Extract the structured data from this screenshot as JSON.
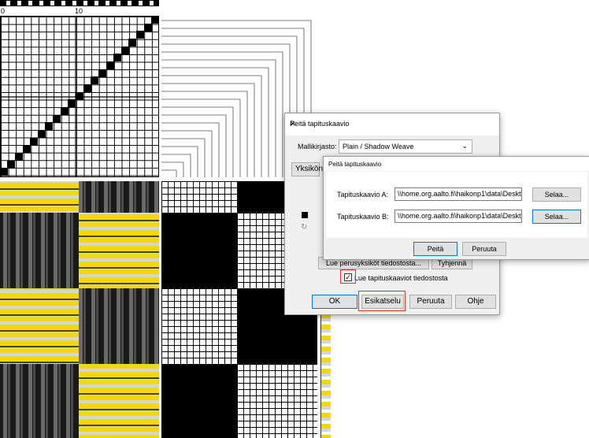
{
  "ruler": {
    "label_start": "0",
    "label_ten": "10"
  },
  "dialog_back": {
    "title": "Peitä tapituskaavio",
    "library_label": "Mallikirjasto:",
    "library_value": "Plain / Shadow Weave",
    "units_label": "Yksikön",
    "read_units_button": "Lue perusyksiköt tiedostosta...",
    "clear_button": "Tyhjennä",
    "read_tieups_label": "Lue tapituskaaviot tiedostosta",
    "ok_button": "OK",
    "preview_button": "Esikatselu",
    "cancel_button": "Peruuta",
    "help_button": "Ohje"
  },
  "dialog_front": {
    "title": "Peitä tapituskaavio",
    "tieup_a_label": "Tapituskaavio A:",
    "tieup_a_value": "\\\\home.org.aalto.fi\\haikonp1\\data\\Desktop\\AO",
    "tieup_b_label": "Tapituskaavio B:",
    "tieup_b_value": "\\\\home.org.aalto.fi\\haikonp1\\data\\Desktop\\AO",
    "browse_label": "Selaa...",
    "cover_button": "Peitä",
    "cancel_button": "Peruuta"
  },
  "colors": {
    "yellow": "#f5d800",
    "light_blue": "#ccd6ee",
    "dark": "#3a3a3a",
    "highlight": "#e03030",
    "accent": "#0078d7"
  },
  "icons": [
    "close-icon",
    "chevron-down-icon",
    "checkbox-checked-icon",
    "black-square-icon",
    "refresh-icon"
  ]
}
